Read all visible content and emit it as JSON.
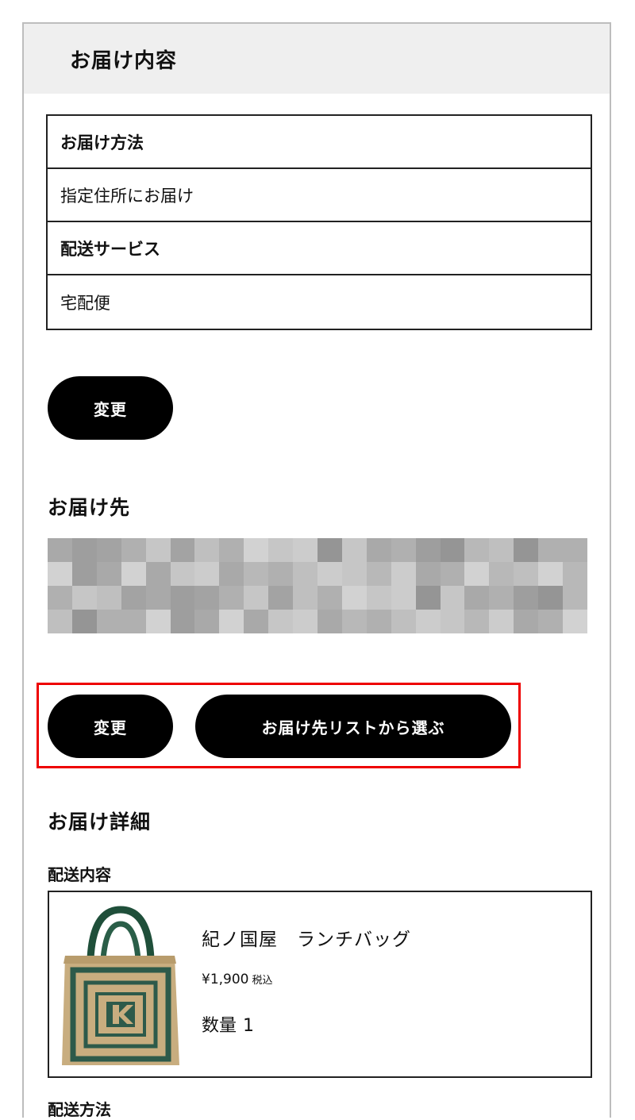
{
  "header": {
    "title": "お届け内容"
  },
  "delivery_table": {
    "rows": [
      {
        "label": "お届け方法",
        "is_header": true
      },
      {
        "label": "指定住所にお届け",
        "is_header": false
      },
      {
        "label": "配送サービス",
        "is_header": true
      },
      {
        "label": "宅配便",
        "is_header": false
      }
    ]
  },
  "buttons": {
    "change_method": "変更",
    "change_address": "変更",
    "choose_from_list": "お届け先リストから選ぶ"
  },
  "address": {
    "title": "お届け先",
    "redacted": true
  },
  "details": {
    "title": "お届け詳細",
    "content_label": "配送内容",
    "method_label": "配送方法"
  },
  "product": {
    "name": "紀ノ国屋　ランチバッグ",
    "price": "¥1,900",
    "tax_label": "税込",
    "quantity_label": "数量",
    "quantity": "1"
  },
  "colors": {
    "button_bg": "#000000",
    "highlight": "#e00000",
    "header_bg": "#efefef"
  }
}
